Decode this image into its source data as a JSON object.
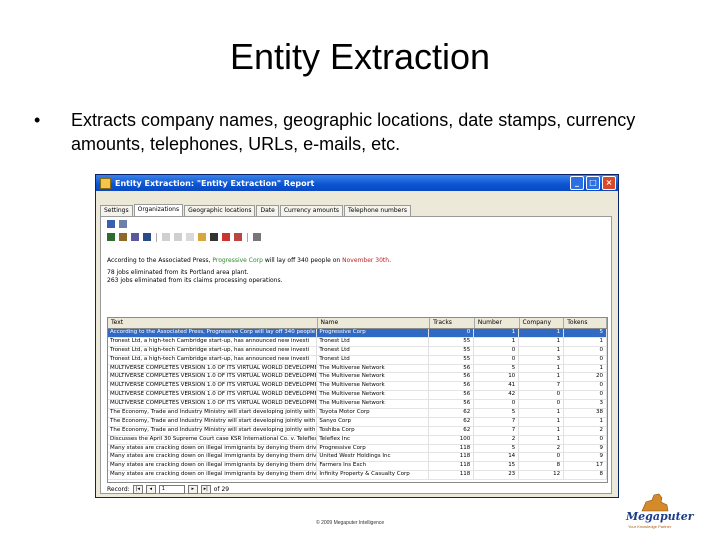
{
  "slide": {
    "title": "Entity Extraction",
    "bullet_symbol": "•",
    "bullet": "Extracts company names, geographic locations, date stamps, currency amounts, telephones, URLs, e-mails, etc."
  },
  "window": {
    "title": "Entity Extraction: \"Entity Extraction\" Report",
    "tabs": [
      "Settings",
      "Organizations",
      "Geographic locations",
      "Date",
      "Currency amounts",
      "Telephone numbers"
    ],
    "active_tab": "Organizations",
    "note": {
      "line1_pre": "According to the Associated Press, ",
      "line1_company": "Progressive Corp",
      "line1_mid": " will lay off 340 people on ",
      "line1_date": "November 30th",
      "line1_post": ".",
      "line2": "78 jobs eliminated from its Portland area plant.",
      "line3": "263 jobs eliminated from its claims processing operations."
    },
    "grid": {
      "headers": [
        "Text",
        "Name",
        "Tracks",
        "Number",
        "Company",
        "Tokens"
      ],
      "rows": [
        [
          "According to the Associated Press, Progressive Corp will lay off 340 people",
          "Progressive Corp",
          "0",
          "1",
          "1",
          "5"
        ],
        [
          "Tronest Ltd, a high-tech Cambridge start-up, has announced new investi",
          "Tronest Ltd",
          "55",
          "1",
          "1",
          "1"
        ],
        [
          "Tronest Ltd, a high-tech Cambridge start-up, has announced new investi",
          "Tronest Ltd",
          "55",
          "0",
          "1",
          "0"
        ],
        [
          "Tronest Ltd, a high-tech Cambridge start-up, has announced new investi",
          "Tronest Ltd",
          "55",
          "0",
          "3",
          "0"
        ],
        [
          "MULTIVERSE COMPLETES VERSION 1.0 OF ITS VIRTUAL WORLD DEVELOPMENT",
          "The Multiverse Network",
          "56",
          "5",
          "1",
          "1"
        ],
        [
          "MULTIVERSE COMPLETES VERSION 1.0 OF ITS VIRTUAL WORLD DEVELOPMENT",
          "The Multiverse Network",
          "56",
          "10",
          "1",
          "20"
        ],
        [
          "MULTIVERSE COMPLETES VERSION 1.0 OF ITS VIRTUAL WORLD DEVELOPMENT",
          "The Multiverse Network",
          "56",
          "41",
          "7",
          "0"
        ],
        [
          "MULTIVERSE COMPLETES VERSION 1.0 OF ITS VIRTUAL WORLD DEVELOPMENT",
          "The Multiverse Network",
          "56",
          "42",
          "0",
          "0"
        ],
        [
          "MULTIVERSE COMPLETES VERSION 1.0 OF ITS VIRTUAL WORLD DEVELOPMENT",
          "The Multiverse Network",
          "56",
          "0",
          "0",
          "3"
        ],
        [
          "The Economy, Trade and Industry Ministry will start developing jointly with",
          "Toyota Motor Corp",
          "62",
          "5",
          "1",
          "38"
        ],
        [
          "The Economy, Trade and Industry Ministry will start developing jointly with",
          "Sanyo Corp",
          "62",
          "7",
          "1",
          "1"
        ],
        [
          "The Economy, Trade and Industry Ministry will start developing jointly with",
          "Toshiba Corp",
          "62",
          "7",
          "1",
          "2"
        ],
        [
          "Discusses the April 30 Supreme Court case KSR International Co. v. Teleflex",
          "Teleflex Inc",
          "100",
          "2",
          "1",
          "0"
        ],
        [
          "Many states are cracking down on illegal immigrants by denying them drive",
          "Progressive Corp",
          "118",
          "5",
          "2",
          "9"
        ],
        [
          "Many states are cracking down on illegal immigrants by denying them drive",
          "United Westr Holdings Inc",
          "118",
          "14",
          "0",
          "9"
        ],
        [
          "Many states are cracking down on illegal immigrants by denying them drive",
          "Farmers Ins Exch",
          "118",
          "15",
          "8",
          "17"
        ],
        [
          "Many states are cracking down on illegal immigrants by denying them drive",
          "Infinity Property & Casualty Corp",
          "118",
          "23",
          "12",
          "8"
        ]
      ]
    },
    "nav": {
      "label": "Record:",
      "current": "1",
      "total": "of 29"
    }
  },
  "footer": "© 2009 Megaputer Intelligence",
  "logo": {
    "name": "Megaputer",
    "tagline": "Your Knowledge Partner"
  },
  "colors": {
    "titlebar": "#0b54d2",
    "selected_row": "#316ac5",
    "company_highlight": "#2a8a2a",
    "date_highlight": "#c02020"
  }
}
